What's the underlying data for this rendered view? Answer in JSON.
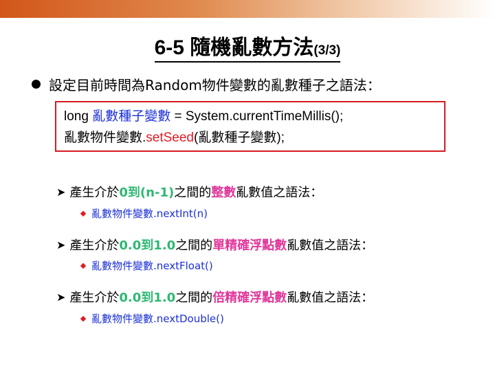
{
  "title": {
    "main": "6-5 隨機亂數方法",
    "sub": "(3/3)"
  },
  "bullet": {
    "text": "設定目前時間為Random物件變數的亂數種子之語法："
  },
  "code": {
    "line1_a": "long ",
    "line1_b": "亂數種子變數",
    "line1_c": " = System.currentTimeMillis();",
    "line2_a": "亂數物件變數.",
    "line2_b": "setSeed",
    "line2_c": "(亂數種子變數);"
  },
  "items": [
    {
      "prefix": "產生介於",
      "range": "0到(n-1)",
      "mid": "之間的",
      "kind": "整數",
      "suffix": "亂數值之語法：",
      "method": "亂數物件變數.nextInt(n)"
    },
    {
      "prefix": "產生介於",
      "range": "0.0到1.0",
      "mid": "之間的",
      "kind": "單精確浮點數",
      "suffix": "亂數值之語法：",
      "method": "亂數物件變數.nextFloat()"
    },
    {
      "prefix": "產生介於",
      "range": "0.0到1.0",
      "mid": "之間的",
      "kind": "倍精確浮點數",
      "suffix": "亂數值之語法：",
      "method": "亂數物件變數.nextDouble()"
    }
  ],
  "colors": {
    "top_bar": "#d2561a",
    "box_border": "#d71920",
    "code_blue": "#1a2fd6",
    "code_red": "#e01b24",
    "range_green": "#2eb872",
    "kind_magenta": "#e0389b"
  },
  "icons": {
    "bullet": "filled-circle",
    "sub": "arrow-right-icon",
    "detail": "diamond-icon"
  }
}
